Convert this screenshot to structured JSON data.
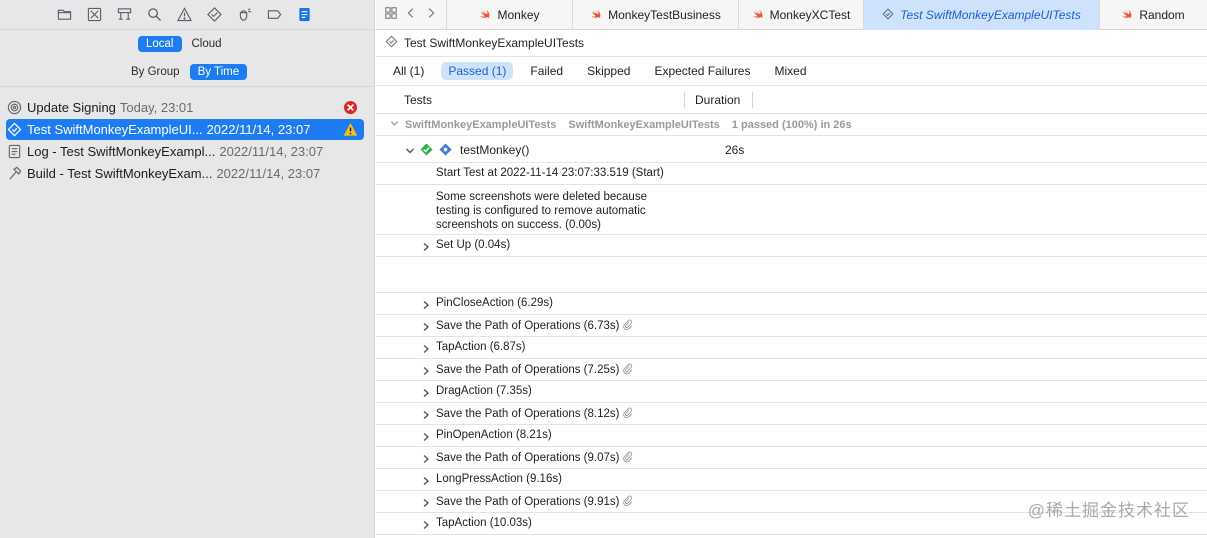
{
  "sidebar": {
    "toolbar_icons": [
      "folder-icon",
      "source-control-icon",
      "hierarchy-icon",
      "search-icon",
      "warning-icon",
      "test-icon",
      "debug-icon",
      "breakpoint-icon",
      "report-icon"
    ],
    "location_tabs": {
      "local": "Local",
      "cloud": "Cloud"
    },
    "grouping_tabs": {
      "by_group": "By Group",
      "by_time": "By Time"
    },
    "history": [
      {
        "name": "Update Signing",
        "date": "Today, 23:01",
        "icon": "gear-icon",
        "status": "error"
      },
      {
        "name": "Test SwiftMonkeyExampleUI...",
        "date": "2022/11/14, 23:07",
        "icon": "test-diamond-icon",
        "status": "warning"
      },
      {
        "name": "Log - Test SwiftMonkeyExampl...",
        "date": "2022/11/14, 23:07",
        "icon": "log-icon",
        "status": ""
      },
      {
        "name": "Build - Test SwiftMonkeyExam...",
        "date": "2022/11/14, 23:07",
        "icon": "hammer-icon",
        "status": ""
      }
    ]
  },
  "tabs": [
    {
      "label": "Monkey",
      "icon": "swift-icon"
    },
    {
      "label": "MonkeyTestBusiness",
      "icon": "swift-icon"
    },
    {
      "label": "MonkeyXCTest",
      "icon": "swift-icon"
    },
    {
      "label": "Test SwiftMonkeyExampleUITests",
      "icon": "test-diamond-icon"
    },
    {
      "label": "Random",
      "icon": "swift-icon"
    }
  ],
  "breadcrumb": {
    "title": "Test SwiftMonkeyExampleUITests"
  },
  "filters": {
    "all": "All (1)",
    "passed": "Passed (1)",
    "failed": "Failed",
    "skipped": "Skipped",
    "expected": "Expected Failures",
    "mixed": "Mixed"
  },
  "columns": {
    "tests": "Tests",
    "duration": "Duration"
  },
  "group": {
    "target": "SwiftMonkeyExampleUITests",
    "class": "SwiftMonkeyExampleUITests",
    "summary": "1 passed (100%) in 26s"
  },
  "test": {
    "name": "testMonkey()",
    "duration": "26s"
  },
  "log": {
    "start": "Start Test at 2022-11-14 23:07:33.519 (Start)",
    "note_line1": "Some screenshots were deleted because",
    "note_line2": "testing is configured to remove automatic",
    "note_line3": "screenshots on success. (0.00s)"
  },
  "setup": "Set Up (0.04s)",
  "activities": [
    {
      "label": "PinCloseAction (6.29s)",
      "attachment": false
    },
    {
      "label": "Save the Path of Operations (6.73s)",
      "attachment": true
    },
    {
      "label": "TapAction (6.87s)",
      "attachment": false
    },
    {
      "label": "Save the Path of Operations (7.25s)",
      "attachment": true
    },
    {
      "label": "DragAction (7.35s)",
      "attachment": false
    },
    {
      "label": "Save the Path of Operations (8.12s)",
      "attachment": true
    },
    {
      "label": "PinOpenAction (8.21s)",
      "attachment": false
    },
    {
      "label": "Save the Path of Operations (9.07s)",
      "attachment": true
    },
    {
      "label": "LongPressAction (9.16s)",
      "attachment": false
    },
    {
      "label": "Save the Path of Operations (9.91s)",
      "attachment": true
    },
    {
      "label": "TapAction (10.03s)",
      "attachment": false
    }
  ],
  "watermark": "@稀土掘金技术社区",
  "colors": {
    "accent": "#1e7cf2",
    "pass": "#2fb14a",
    "error": "#d82a2a",
    "warning": "#f3c21b"
  }
}
